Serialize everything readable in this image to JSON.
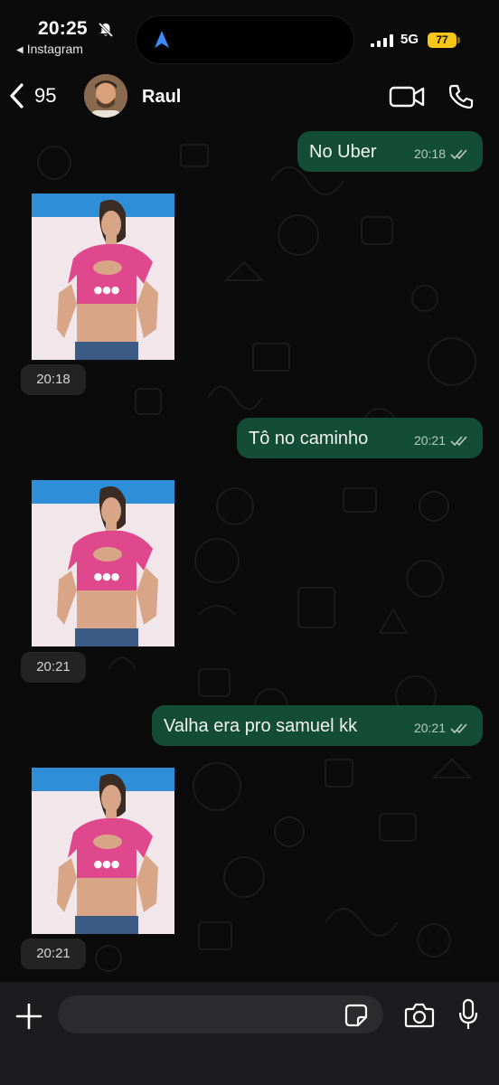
{
  "status_bar": {
    "time": "20:25",
    "back_app": "Instagram",
    "network": "5G",
    "battery": "77"
  },
  "header": {
    "unread_count": "95",
    "contact_name": "Raul"
  },
  "messages": [
    {
      "type": "outgoing-text",
      "text": "No Uber",
      "time": "20:18"
    },
    {
      "type": "incoming-image",
      "time": "20:18"
    },
    {
      "type": "outgoing-text",
      "text": "Tô no caminho",
      "time": "20:21"
    },
    {
      "type": "incoming-image",
      "time": "20:21"
    },
    {
      "type": "outgoing-text",
      "text": "Valha era pro samuel kk",
      "time": "20:21"
    },
    {
      "type": "incoming-image",
      "time": "20:21"
    }
  ],
  "composer": {
    "placeholder": ""
  },
  "colors": {
    "background": "#0b0b0b",
    "outgoing_bubble": "#144d37",
    "battery": "#f5c518",
    "time_chip": "#232323",
    "accent_blue": "#3d8bff"
  },
  "icons": [
    "bell-off-icon",
    "navigation-arrow-icon",
    "signal-icon",
    "back-chevron-icon",
    "video-call-icon",
    "phone-icon",
    "double-check-icon",
    "plus-icon",
    "sticker-icon",
    "camera-icon",
    "microphone-icon"
  ]
}
